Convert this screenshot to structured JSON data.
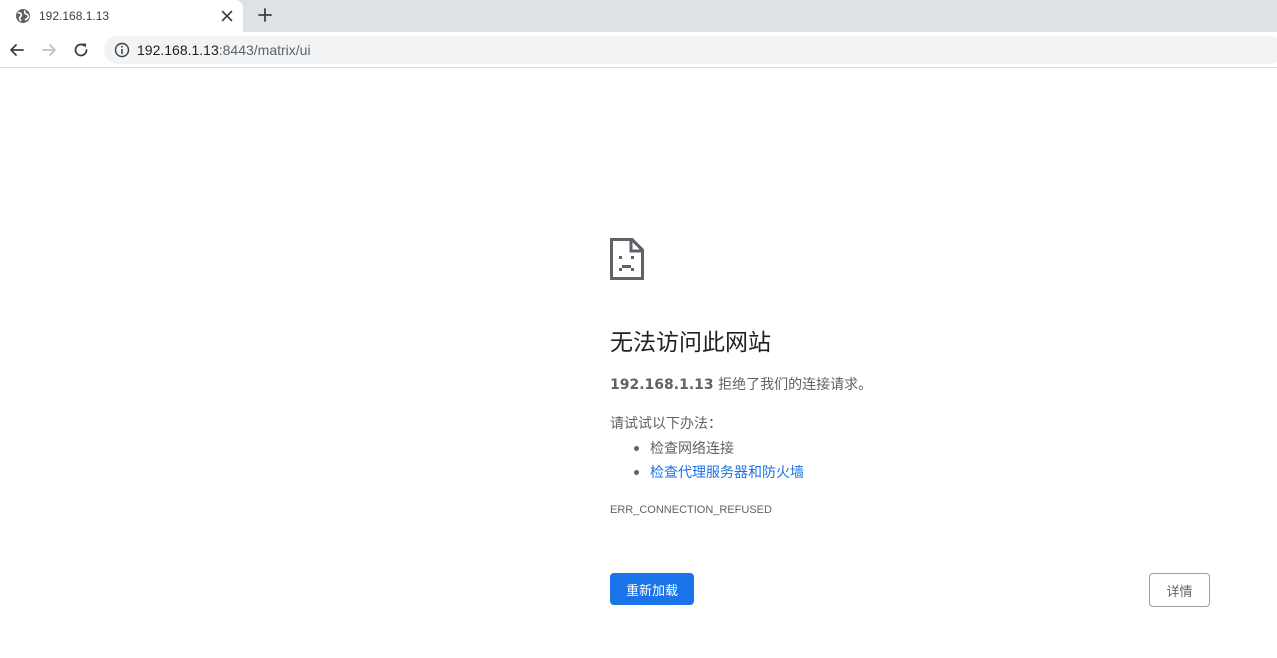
{
  "tab": {
    "title": "192.168.1.13",
    "favicon": "globe-icon",
    "close_icon": "close-icon"
  },
  "new_tab_icon": "plus-icon",
  "toolbar": {
    "back_icon": "back-arrow-icon",
    "forward_icon": "forward-arrow-icon",
    "reload_icon": "reload-icon",
    "info_icon": "info-icon"
  },
  "omnibox": {
    "host": "192.168.1.13",
    "rest": ":8443/matrix/ui"
  },
  "error": {
    "icon": "sad-document-icon",
    "title": "无法访问此网站",
    "host": "192.168.1.13",
    "summary_suffix": " 拒绝了我们的连接请求。",
    "try_label": "请试试以下办法：",
    "suggestions": [
      "检查网络连接",
      "检查代理服务器和防火墙"
    ],
    "code": "ERR_CONNECTION_REFUSED",
    "reload_label": "重新加载",
    "details_label": "详情"
  },
  "colors": {
    "tabstrip_bg": "#dee1e6",
    "accent": "#1a73e8",
    "text_secondary": "#5f6368"
  }
}
